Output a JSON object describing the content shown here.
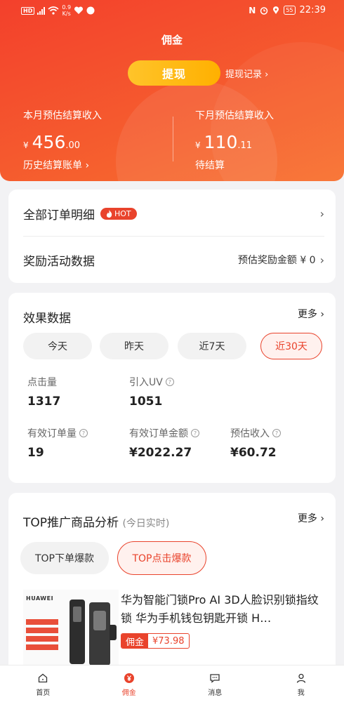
{
  "status_bar": {
    "hd": "HD",
    "speed_value": "0.9",
    "speed_unit": "K/s",
    "nfc": "N",
    "battery": "55",
    "time": "22:39"
  },
  "page": {
    "title": "佣金"
  },
  "withdraw": {
    "button_label": "提现",
    "record_label": "提现记录 ›"
  },
  "income": {
    "this_month": {
      "label": "本月预估结算收入",
      "currency": "¥",
      "integer": "456",
      "decimal": ".00",
      "link": "历史结算账单 ›"
    },
    "next_month": {
      "label": "下月预估结算收入",
      "currency": "¥",
      "integer": "110",
      "decimal": ".11",
      "link": "待结算"
    }
  },
  "entries": {
    "all_orders": {
      "title": "全部订单明细",
      "hot_badge": "HOT"
    },
    "rewards": {
      "title": "奖励活动数据",
      "value": "预估奖励金额 ¥ 0"
    }
  },
  "effect": {
    "title": "效果数据",
    "more": "更多 ›",
    "ranges": [
      "今天",
      "昨天",
      "近7天",
      "近30天"
    ],
    "active_range": "近30天",
    "metrics": {
      "clicks": {
        "label": "点击量",
        "value": "1317"
      },
      "uv": {
        "label": "引入UV",
        "value": "1051"
      },
      "orders": {
        "label": "有效订单量",
        "value": "19"
      },
      "order_amount": {
        "label": "有效订单金额",
        "value": "¥2022.27"
      },
      "est_income": {
        "label": "预估收入",
        "value": "¥60.72"
      }
    }
  },
  "top_products": {
    "title": "TOP推广商品分析",
    "subtitle": "(今日实时)",
    "more": "更多 ›",
    "tabs": [
      "TOP下单爆款",
      "TOP点击爆款"
    ],
    "active_tab": "TOP点击爆款",
    "product": {
      "brand_on_image": "HUAWEI",
      "title": "华为智能门锁Pro AI 3D人脸识别锁指纹锁 华为手机钱包钥匙开锁 H…",
      "commission_label": "佣金",
      "commission_value": "¥73.98"
    }
  },
  "tabbar": {
    "items": [
      {
        "label": "首页",
        "icon": "home-icon"
      },
      {
        "label": "佣金",
        "icon": "yen-icon"
      },
      {
        "label": "消息",
        "icon": "message-icon"
      },
      {
        "label": "我",
        "icon": "person-icon"
      }
    ],
    "active": "佣金"
  },
  "colors": {
    "accent": "#e9432c",
    "hero_start": "#f3402c",
    "hero_end": "#f8712f",
    "withdraw_button": "#ffb000"
  }
}
